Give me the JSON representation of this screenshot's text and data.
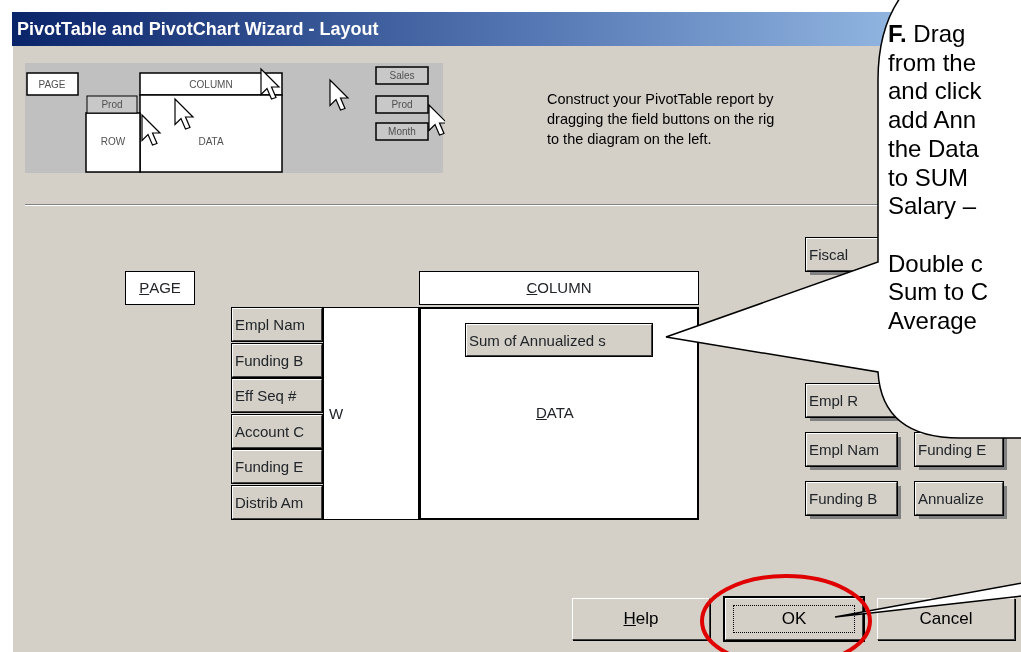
{
  "window": {
    "title": "PivotTable and PivotChart Wizard - Layout"
  },
  "diagram": {
    "page": "PAGE",
    "column": "COLUMN",
    "row_field": "Prod",
    "row": "ROW",
    "data": "DATA",
    "fields": [
      "Sales",
      "Prod",
      "Month"
    ]
  },
  "instructions": [
    "Construct your PivotTable report by",
    "dragging the field buttons on the rig",
    "to the diagram on the left."
  ],
  "layout": {
    "page_label": "PAGE",
    "column_label": "COLUMN",
    "row_label": "W",
    "data_label": "DATA",
    "row_fields": [
      "Empl Nam",
      "Funding B",
      "Eff Seq #",
      "Account C",
      "Funding E",
      "Distrib Am"
    ],
    "data_fields": [
      "Sum of Annualized s"
    ]
  },
  "field_list": {
    "column_1": [
      "Fiscal",
      "Empl R",
      "Empl Nam",
      "Funding B"
    ],
    "column_2": [
      "Funding E",
      "Annualize"
    ]
  },
  "buttons": [
    {
      "label": "Help",
      "default": false
    },
    {
      "label": "OK",
      "default": true
    },
    {
      "label": "Cancel",
      "default": false
    }
  ],
  "callout": {
    "paragraphs": [
      [
        "**F.** Drag",
        "from the",
        "and click",
        "add Ann",
        "the Data",
        "to SUM",
        "Salary –"
      ],
      [
        "Double c",
        "Sum to C",
        "Average"
      ]
    ]
  }
}
